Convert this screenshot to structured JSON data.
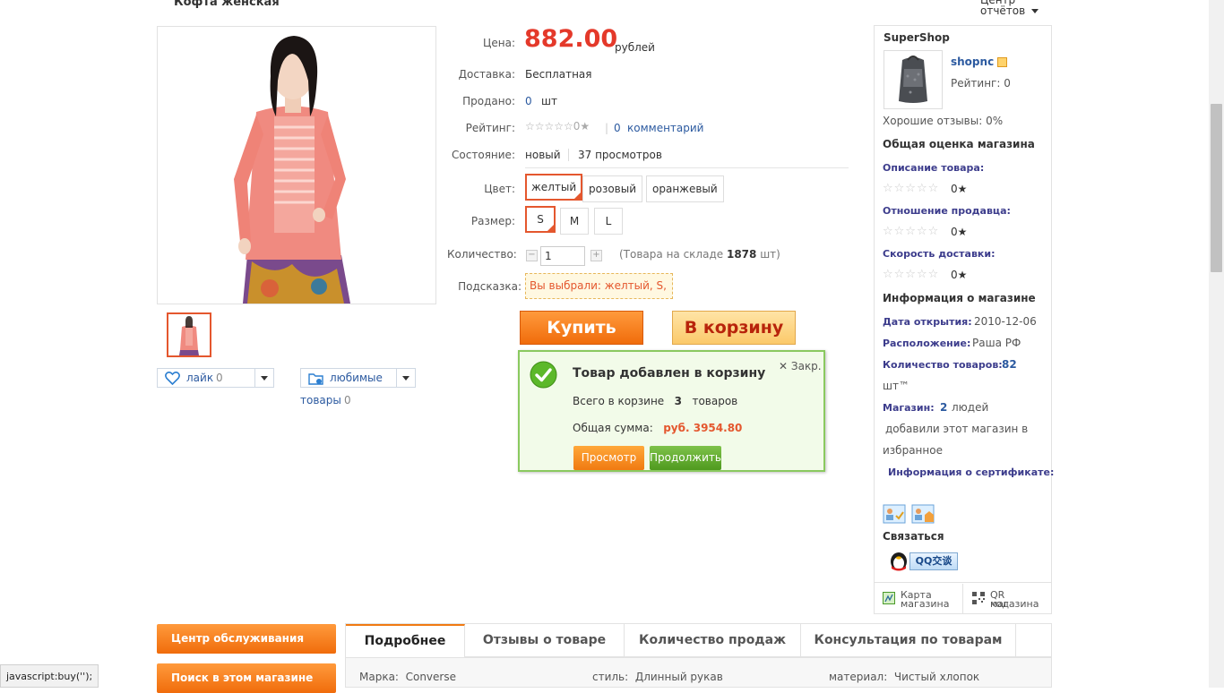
{
  "header": {
    "title": "Кофта женская",
    "report_center": "Центр отчётов"
  },
  "gallery": {
    "like_label": "лайк",
    "like_count": "0",
    "fav_label_1": "любимые",
    "fav_label_2": "товары",
    "fav_count": "0"
  },
  "product": {
    "price_label": "Цена:",
    "price": "882.00",
    "price_unit": "рублей",
    "delivery_label": "Доставка:",
    "delivery": "Бесплатная",
    "sold_label": "Продано:",
    "sold": "0",
    "sold_unit": "шт",
    "rating_label": "Рейтинг:",
    "rating_stars": "☆☆☆☆☆0★",
    "rating_sep": "|",
    "comments_count": "0",
    "comments_label": "комментарий",
    "state_label": "Состояние:",
    "state": "новый",
    "views": "37 просмотров",
    "color_label": "Цвет:",
    "colors": [
      "желтый",
      "розовый",
      "оранжевый"
    ],
    "size_label": "Размер:",
    "sizes": [
      "S",
      "M",
      "L"
    ],
    "qty_label": "Количество:",
    "qty": "1",
    "stock_pre": "(Товара на складе",
    "stock": "1878",
    "stock_unit": "шт)",
    "hint_label": "Подсказка:",
    "hint": "Вы выбрали:  желтый,  S,",
    "buy": "Купить",
    "cart": "В корзину"
  },
  "popup": {
    "title": "Товар добавлен в корзину",
    "close": "Закр.",
    "line1_pre": "Всего в корзине",
    "line1_count": "3",
    "line1_post": "товаров",
    "line2_pre": "Общая сумма:",
    "line2_sum": "руб.   3954.80",
    "view_btn": "Просмотр",
    "continue_btn": "Продолжить"
  },
  "shop": {
    "title": "SuperShop",
    "name": "shopnc",
    "rating": "Рейтинг:  0",
    "good_reviews": "Хорошие отзывы:  0%",
    "overall_title": "Общая оценка магазина",
    "desc_label": "Описание товара:",
    "desc_stars": "☆☆☆☆☆",
    "desc_val": "0★",
    "seller_label": "Отношение продавца:",
    "seller_stars": "☆☆☆☆☆",
    "seller_val": "0★",
    "speed_label": "Скорость доставки:",
    "speed_stars": "☆☆☆☆☆",
    "speed_val": "0★",
    "info_title": "Информация о магазине",
    "open_label": "Дата открытия:",
    "open_val": "2010-12-06",
    "loc_label": "Расположение:",
    "loc_val": "Раша РФ",
    "count_label": "Количество товаров:",
    "count_val": "82",
    "count_unit": "шт™",
    "store_label": "Магазин:",
    "store_val": "2",
    "store_post": "людей",
    "store_post2": "добавили этот магазин в",
    "store_post3": "избранное",
    "cert_label": "Информация о сертификате:",
    "contact": "Связаться",
    "qq": "QQ交谈",
    "map_1": "Карта",
    "map_2": "магазина",
    "qr_1": "QR код",
    "qr_2": "магазина"
  },
  "bottom": {
    "service_center": "Центр обслуживания",
    "search_shop": "Поиск в этом магазине",
    "tabs": [
      "Подробнее",
      "Отзывы о товаре",
      "Количество продаж",
      "Консультация по товарам"
    ],
    "brand_label": "Марка:",
    "brand": "Converse",
    "style_label": "стиль:",
    "style": "Длинный рукав",
    "material_label": "материал:",
    "material": "Чистый хлопок"
  },
  "status_bar": "javascript:buy('');",
  "colors": {
    "accent": "#f06c0b",
    "price": "#e4392a",
    "link": "#2c5aa0",
    "popup_border": "#8ac95f"
  }
}
